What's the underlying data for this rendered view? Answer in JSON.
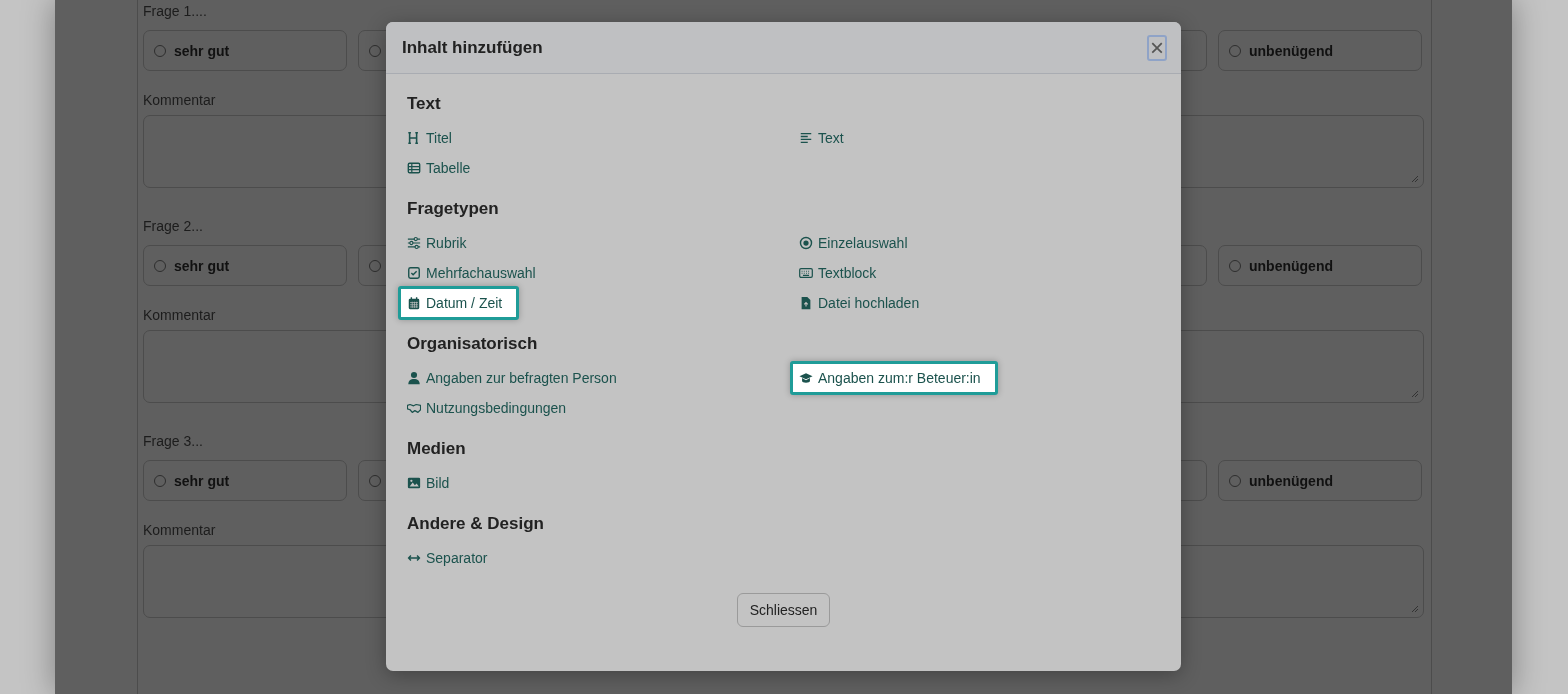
{
  "form": {
    "questions": [
      {
        "label": "Frage 1....",
        "first_option": "sehr gut",
        "last_option": "unbenügend",
        "comment_label": "Kommentar"
      },
      {
        "label": "Frage 2...",
        "first_option": "sehr gut",
        "last_option": "unbenügend",
        "comment_label": "Kommentar"
      },
      {
        "label": "Frage 3...",
        "first_option": "sehr gut",
        "last_option": "unbenügend",
        "comment_label": "Kommentar"
      }
    ]
  },
  "dialog": {
    "title": "Inhalt hinzufügen",
    "close_symbol": "×",
    "sections": [
      {
        "heading": "Text",
        "items": [
          {
            "label": "Titel",
            "highlighted": false
          },
          {
            "label": "Text",
            "highlighted": false
          },
          {
            "label": "Tabelle",
            "highlighted": false
          }
        ]
      },
      {
        "heading": "Fragetypen",
        "items": [
          {
            "label": "Rubrik",
            "highlighted": false
          },
          {
            "label": "Einzelauswahl",
            "highlighted": false
          },
          {
            "label": "Mehrfachauswahl",
            "highlighted": false
          },
          {
            "label": "Textblock",
            "highlighted": false
          },
          {
            "label": "Datum / Zeit",
            "highlighted": true
          },
          {
            "label": "Datei hochladen",
            "highlighted": false
          }
        ]
      },
      {
        "heading": "Organisatorisch",
        "items": [
          {
            "label": "Angaben zur befragten Person",
            "highlighted": false
          },
          {
            "label": "Angaben zum:r Beteuer:in",
            "highlighted": true
          },
          {
            "label": "Nutzungsbedingungen",
            "highlighted": false
          }
        ]
      },
      {
        "heading": "Medien",
        "items": [
          {
            "label": "Bild",
            "highlighted": false
          }
        ]
      },
      {
        "heading": "Andere & Design",
        "items": [
          {
            "label": "Separator",
            "highlighted": false
          }
        ]
      }
    ],
    "footer_button": "Schliessen"
  }
}
